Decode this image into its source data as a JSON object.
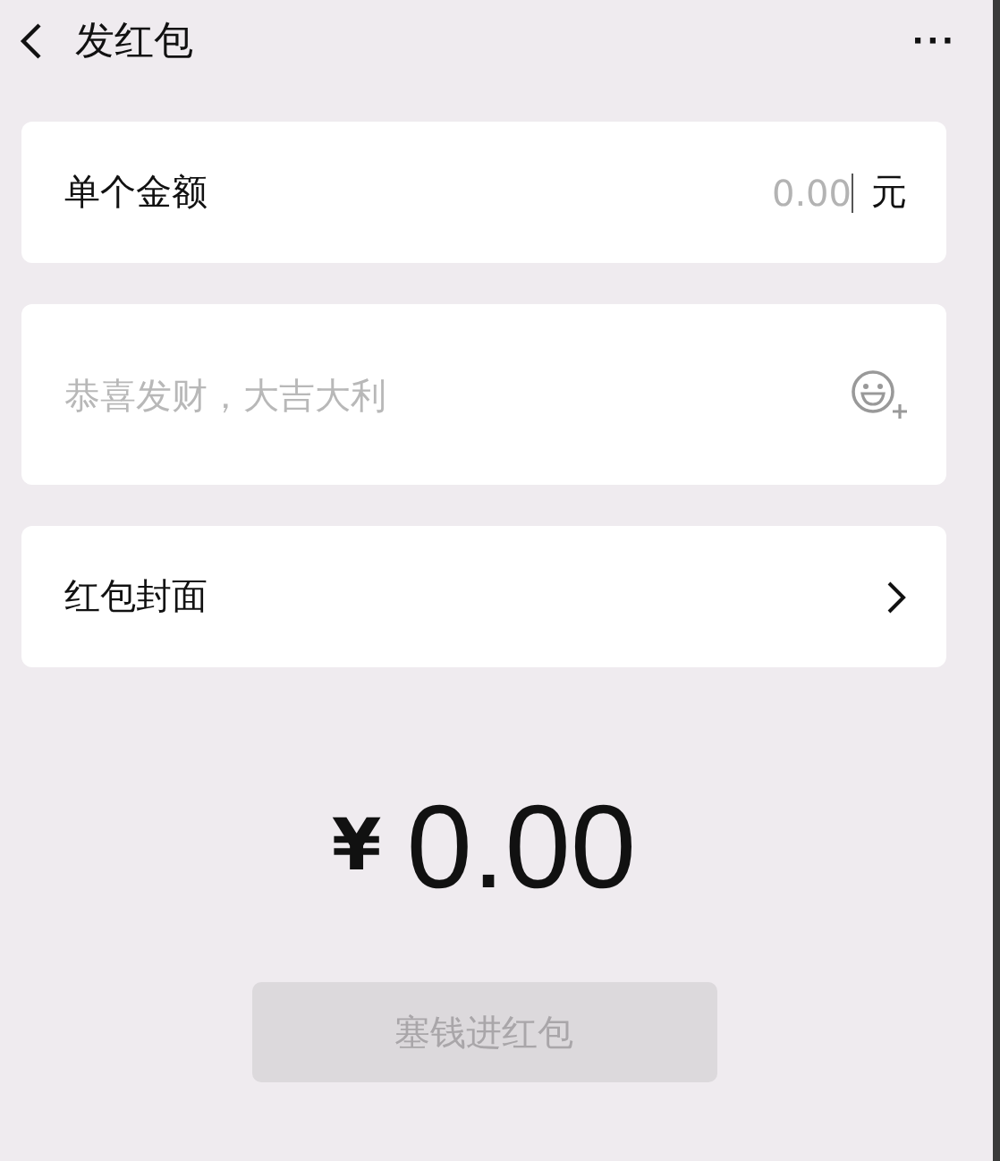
{
  "header": {
    "title": "发红包",
    "more": "···"
  },
  "amount_row": {
    "label": "单个金额",
    "placeholder": "0.00",
    "unit": "元"
  },
  "greeting": {
    "placeholder": "恭喜发财，大吉大利"
  },
  "cover_row": {
    "label": "红包封面"
  },
  "total": {
    "currency": "¥",
    "amount": "0.00"
  },
  "submit": {
    "label": "塞钱进红包",
    "disabled": true
  }
}
